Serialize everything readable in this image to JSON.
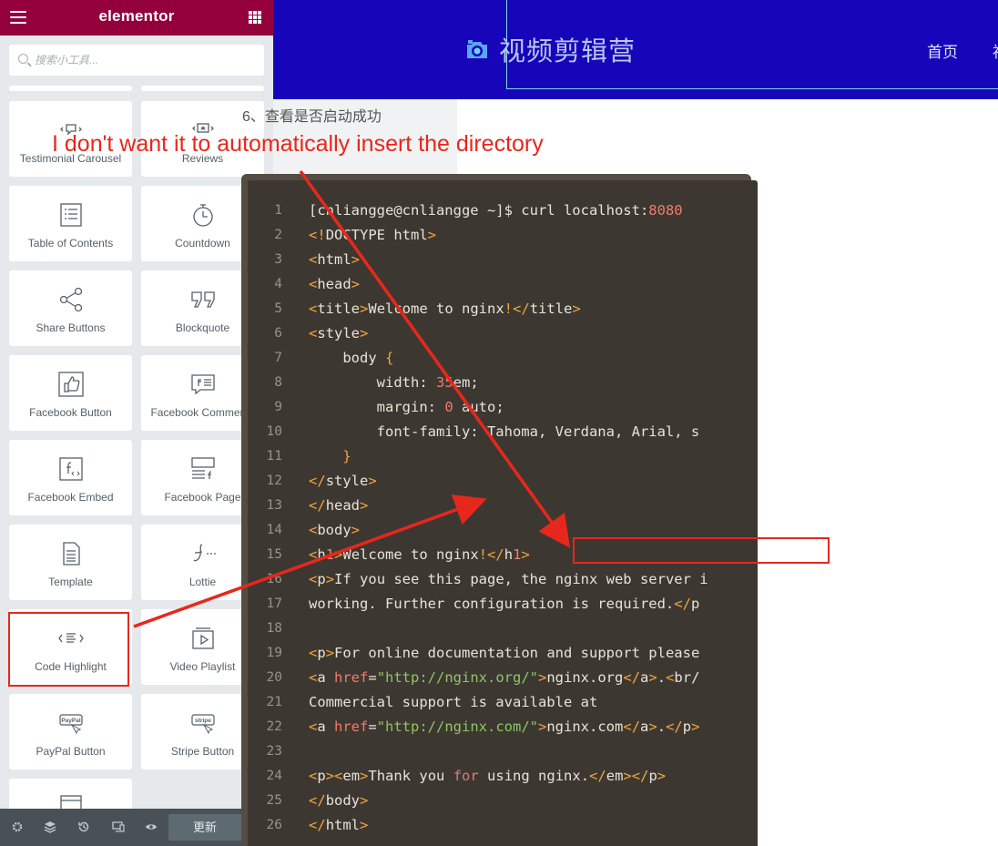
{
  "panel": {
    "brand": "elementor",
    "search_placeholder": "搜索小工具...",
    "widgets": [
      {
        "label": "Testimonial Carousel",
        "icon": "testimonial-carousel-icon"
      },
      {
        "label": "Reviews",
        "icon": "reviews-icon"
      },
      {
        "label": "Table of Contents",
        "icon": "table-of-contents-icon"
      },
      {
        "label": "Countdown",
        "icon": "countdown-icon"
      },
      {
        "label": "Share Buttons",
        "icon": "share-icon"
      },
      {
        "label": "Blockquote",
        "icon": "blockquote-icon"
      },
      {
        "label": "Facebook Button",
        "icon": "thumbs-up-icon"
      },
      {
        "label": "Facebook Comments",
        "icon": "facebook-comments-icon"
      },
      {
        "label": "Facebook Embed",
        "icon": "facebook-embed-icon"
      },
      {
        "label": "Facebook Page",
        "icon": "facebook-page-icon"
      },
      {
        "label": "Template",
        "icon": "template-icon"
      },
      {
        "label": "Lottie",
        "icon": "lottie-icon"
      },
      {
        "label": "Code Highlight",
        "icon": "code-highlight-icon"
      },
      {
        "label": "Video Playlist",
        "icon": "video-playlist-icon"
      },
      {
        "label": "PayPal Button",
        "icon": "paypal-icon",
        "badge": "PayPal"
      },
      {
        "label": "Stripe Button",
        "icon": "stripe-icon",
        "badge": "stripe"
      }
    ],
    "footer": {
      "update_label": "更新",
      "icons": [
        "settings-icon",
        "layers-icon",
        "history-icon",
        "responsive-icon",
        "preview-eye-icon"
      ]
    }
  },
  "site": {
    "logo_text": "视频剪辑营",
    "nav": [
      "首页",
      "福"
    ]
  },
  "content": {
    "step_text": "6、查看是否启动成功"
  },
  "code": {
    "line_numbers": [
      "1",
      "2",
      "3",
      "4",
      "5",
      "6",
      "7",
      "8",
      "9",
      "10",
      "11",
      "12",
      "13",
      "14",
      "15",
      "16",
      "17",
      "18",
      "19",
      "20",
      "21",
      "22",
      "23",
      "24",
      "25",
      "26"
    ],
    "lines": [
      "[cnliangge@cnliangge ~]$ curl localhost:8080",
      "<!DOCTYPE html>",
      "<html>",
      "<head>",
      "<title>Welcome to nginx!</title>",
      "<style>",
      "    body {",
      "        width: 35em;",
      "        margin: 0 auto;",
      "        font-family: Tahoma, Verdana, Arial, s",
      "    }",
      "</style>",
      "</head>",
      "<body>",
      "<h1>Welcome to nginx!</h1>",
      "<p>If you see this page, the nginx web server i",
      "working. Further configuration is required.</p",
      "",
      "<p>For online documentation and support please",
      "<a href=\"http://nginx.org/\">nginx.org</a>.<br/",
      "Commercial support is available at",
      "<a href=\"http://nginx.com/\">nginx.com</a>.</p>",
      "",
      "<p><em>Thank you for using nginx.</em></p>",
      "</body>",
      "</html>"
    ]
  },
  "annotation": {
    "text": "I don't want it to automatically insert the directory"
  },
  "colors": {
    "panel_header": "#93003c",
    "site_header": "#1706b9",
    "annotation_red": "#e8271c",
    "code_bg": "#3c3831"
  }
}
